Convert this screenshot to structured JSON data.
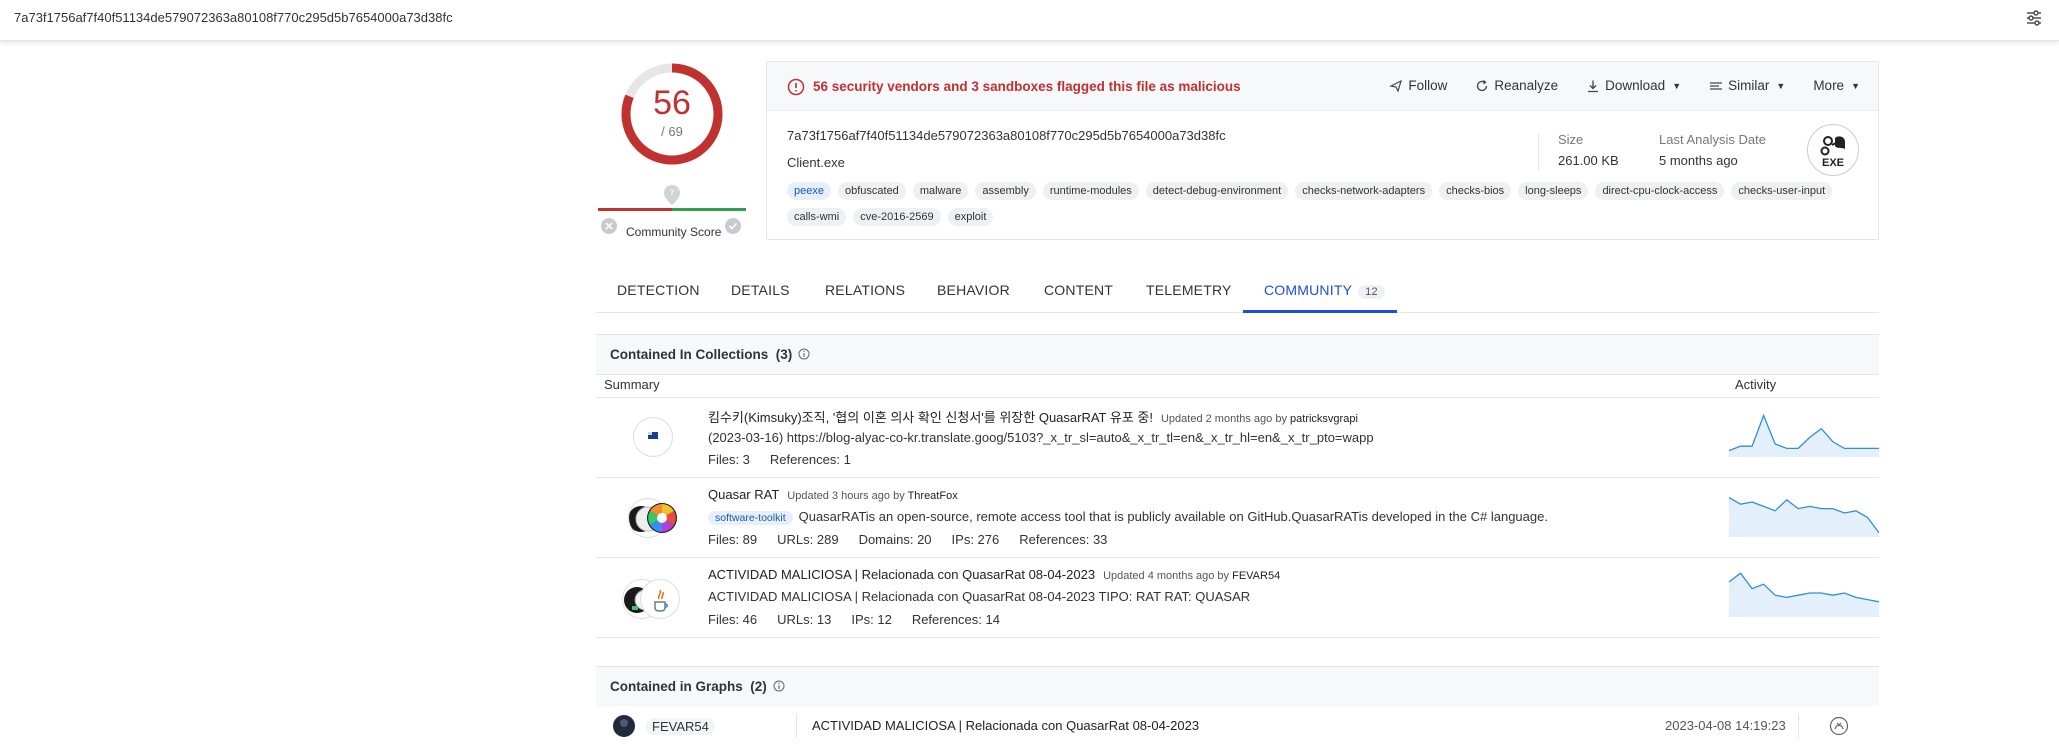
{
  "topbar": {
    "hash": "7a73f1756af7f40f51134de579072363a80108f770c295d5b7654000a73d38fc",
    "menu_icon": "sliders-icon"
  },
  "score": {
    "value": "56",
    "total": "/ 69",
    "community_label": "Community Score"
  },
  "alert": {
    "text": "56 security vendors and 3 sandboxes flagged this file as malicious"
  },
  "actions": [
    {
      "label": "Follow",
      "icon": "follow-icon"
    },
    {
      "label": "Reanalyze",
      "icon": "reanalyze-icon"
    },
    {
      "label": "Download",
      "icon": "download-icon"
    },
    {
      "label": "Similar",
      "icon": "similar-icon"
    },
    {
      "label": "More",
      "icon": ""
    }
  ],
  "file": {
    "hash": "7a73f1756af7f40f51134de579072363a80108f770c295d5b7654000a73d38fc",
    "name": "Client.exe",
    "size_label": "Size",
    "size_value": "261.00 KB",
    "date_label": "Last Analysis Date",
    "date_value": "5 months ago",
    "type_badge": "EXE"
  },
  "tags": [
    "peexe",
    "obfuscated",
    "malware",
    "assembly",
    "runtime-modules",
    "detect-debug-environment",
    "checks-network-adapters",
    "checks-bios",
    "long-sleeps",
    "direct-cpu-clock-access",
    "checks-user-input",
    "calls-wmi",
    "cve-2016-2569",
    "exploit"
  ],
  "tabs": [
    {
      "label": "DETECTION"
    },
    {
      "label": "DETAILS"
    },
    {
      "label": "RELATIONS"
    },
    {
      "label": "BEHAVIOR"
    },
    {
      "label": "CONTENT"
    },
    {
      "label": "TELEMETRY"
    },
    {
      "label": "COMMUNITY",
      "count": "12",
      "active": true
    }
  ],
  "collections": {
    "title": "Contained In Collections",
    "count": "(3)",
    "col_summary": "Summary",
    "col_activity": "Activity",
    "rows": [
      {
        "title": "킴수키(Kimsuky)조직, '협의 이혼 의사 확인 신청서'를 위장한 QuasarRAT 유포 중!",
        "updated": "Updated 2 months ago by",
        "author": "patricksvgrapi",
        "desc": "(2023-03-16) https://blog-alyac-co-kr.translate.goog/5103?_x_tr_sl=auto&_x_tr_tl=en&_x_tr_hl=en&_x_tr_pto=wapp",
        "stats": [
          "Files: 3",
          "References: 1"
        ],
        "activity": [
          0.1,
          0.2,
          0.2,
          0.9,
          0.25,
          0.15,
          0.15,
          0.4,
          0.6,
          0.3,
          0.15,
          0.15,
          0.15,
          0.15
        ]
      },
      {
        "title": "Quasar RAT",
        "updated": "Updated 3 hours ago by",
        "author": "ThreatFox",
        "tag": "software-toolkit",
        "desc": "QuasarRATis an open-source, remote access tool that is publicly available on GitHub.QuasarRATis developed in the C# language.",
        "stats": [
          "Files: 89",
          "URLs: 289",
          "Domains: 20",
          "IPs: 276",
          "References: 33"
        ],
        "activity": [
          0.85,
          0.7,
          0.75,
          0.65,
          0.55,
          0.8,
          0.6,
          0.65,
          0.6,
          0.6,
          0.5,
          0.55,
          0.4,
          0.05
        ]
      },
      {
        "title": "ACTIVIDAD MALICIOSA | Relacionada con QuasarRat 08-04-2023",
        "updated": "Updated 4 months ago by",
        "author": "FEVAR54",
        "desc": "ACTIVIDAD MALICIOSA | Relacionada con QuasarRat 08-04-2023 TIPO: RAT RAT: QUASAR",
        "stats": [
          "Files: 46",
          "URLs: 13",
          "IPs: 12",
          "References: 14"
        ],
        "activity": [
          0.75,
          0.95,
          0.6,
          0.7,
          0.45,
          0.4,
          0.45,
          0.5,
          0.5,
          0.45,
          0.5,
          0.4,
          0.35,
          0.3
        ]
      }
    ]
  },
  "graphs": {
    "title": "Contained in Graphs",
    "count": "(2)",
    "rows": [
      {
        "author": "FEVAR54",
        "title": "ACTIVIDAD MALICIOSA | Relacionada con QuasarRat 08-04-2023",
        "date": "2023-04-08 14:19:23"
      }
    ]
  },
  "colors": {
    "accent": "#1a4fd6",
    "malicious": "#c0312f",
    "good": "#2e9e4f",
    "spark": "#2f8fdc"
  }
}
